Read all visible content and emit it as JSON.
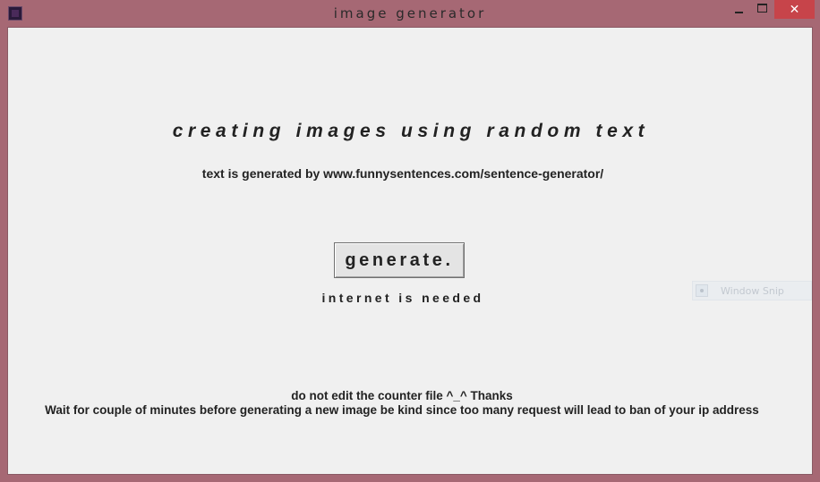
{
  "window": {
    "title": "image generator",
    "close_glyph": "✕"
  },
  "main": {
    "heading": "creating images using random text",
    "subheading": "text is generated by www.funnysentences.com/sentence-generator/",
    "generate_label": "generate.",
    "internet_note": "internet is needed",
    "footer_line1": "do not edit the counter file ^_^ Thanks",
    "footer_line2": "Wait for couple of minutes before generating a new image be kind since too many request will lead to ban of your ip address"
  },
  "overlay": {
    "snip_label": "Window Snip"
  },
  "colors": {
    "frame": "#a66874",
    "client_bg": "#f0f0f0",
    "close_button": "#c7444a",
    "text": "#222222"
  },
  "icons": {
    "app": "app-icon",
    "minimize": "minimize-icon",
    "maximize": "maximize-icon",
    "close": "close-icon",
    "snip": "snip-icon"
  }
}
